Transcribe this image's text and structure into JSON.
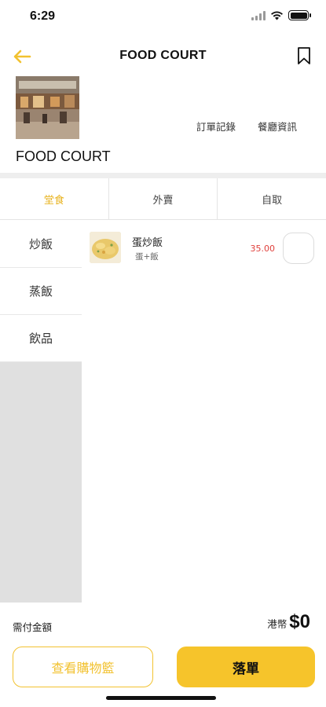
{
  "status_bar": {
    "time": "6:29"
  },
  "nav": {
    "title": "FOOD COURT"
  },
  "restaurant": {
    "name": "FOOD COURT",
    "links": [
      "訂單記錄",
      "餐廳資訊"
    ]
  },
  "mode_tabs": [
    {
      "label": "堂食",
      "active": true
    },
    {
      "label": "外賣",
      "active": false
    },
    {
      "label": "自取",
      "active": false
    }
  ],
  "categories": [
    "炒飯",
    "蒸飯",
    "飲品"
  ],
  "menu_items": [
    {
      "name": "蛋炒飯",
      "description": "蛋+飯",
      "price": "35.00"
    }
  ],
  "footer": {
    "total_label": "需付金額",
    "currency": "港幣",
    "amount": "$0",
    "view_cart_label": "查看購物籃",
    "order_label": "落單"
  },
  "colors": {
    "accent": "#f6c42b",
    "active_tab": "#e8b320",
    "price": "#e0403c"
  }
}
